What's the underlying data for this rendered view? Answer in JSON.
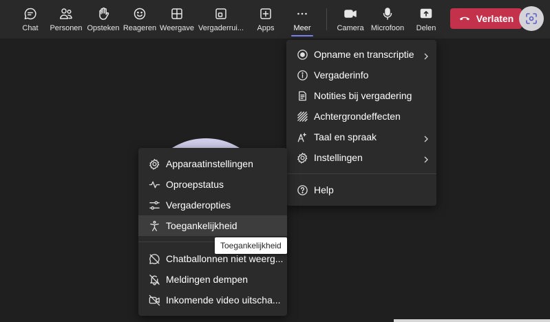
{
  "toolbar": {
    "chat": "Chat",
    "people": "Personen",
    "raise_hand": "Opsteken",
    "react": "Reageren",
    "view": "Weergave",
    "rooms": "Vergaderrui...",
    "apps": "Apps",
    "more": "Meer",
    "camera": "Camera",
    "mic": "Microfoon",
    "share": "Delen",
    "leave": "Verlaten"
  },
  "more_menu": {
    "items": [
      {
        "label": "Opname en transcriptie",
        "icon": "record-icon",
        "submenu": true
      },
      {
        "label": "Vergaderinfo",
        "icon": "info-icon",
        "submenu": false
      },
      {
        "label": "Notities bij vergadering",
        "icon": "notes-icon",
        "submenu": false
      },
      {
        "label": "Achtergrondeffecten",
        "icon": "background-effects-icon",
        "submenu": false
      },
      {
        "label": "Taal en spraak",
        "icon": "language-icon",
        "submenu": true
      },
      {
        "label": "Instellingen",
        "icon": "gear-icon",
        "submenu": true
      },
      {
        "label": "Help",
        "icon": "help-icon",
        "submenu": false
      }
    ]
  },
  "settings_menu": {
    "items": [
      {
        "label": "Apparaatinstellingen",
        "icon": "gear-icon"
      },
      {
        "label": "Oproepstatus",
        "icon": "pulse-icon"
      },
      {
        "label": "Vergaderopties",
        "icon": "sliders-icon"
      },
      {
        "label": "Toegankelijkheid",
        "icon": "accessibility-icon"
      },
      {
        "label": "Chatballonnen niet weerg...",
        "icon": "chat-bubble-off-icon"
      },
      {
        "label": "Meldingen dempen",
        "icon": "bell-off-icon"
      },
      {
        "label": "Inkomende video uitscha...",
        "icon": "video-off-icon"
      }
    ]
  },
  "tooltip": {
    "text": "Toegankelijkheid"
  },
  "colors": {
    "leave": "#c4314b",
    "accent": "#7f85f5",
    "avatar": "#cfcde9",
    "toolbar": "#292929",
    "menu": "#2b2b2b"
  }
}
